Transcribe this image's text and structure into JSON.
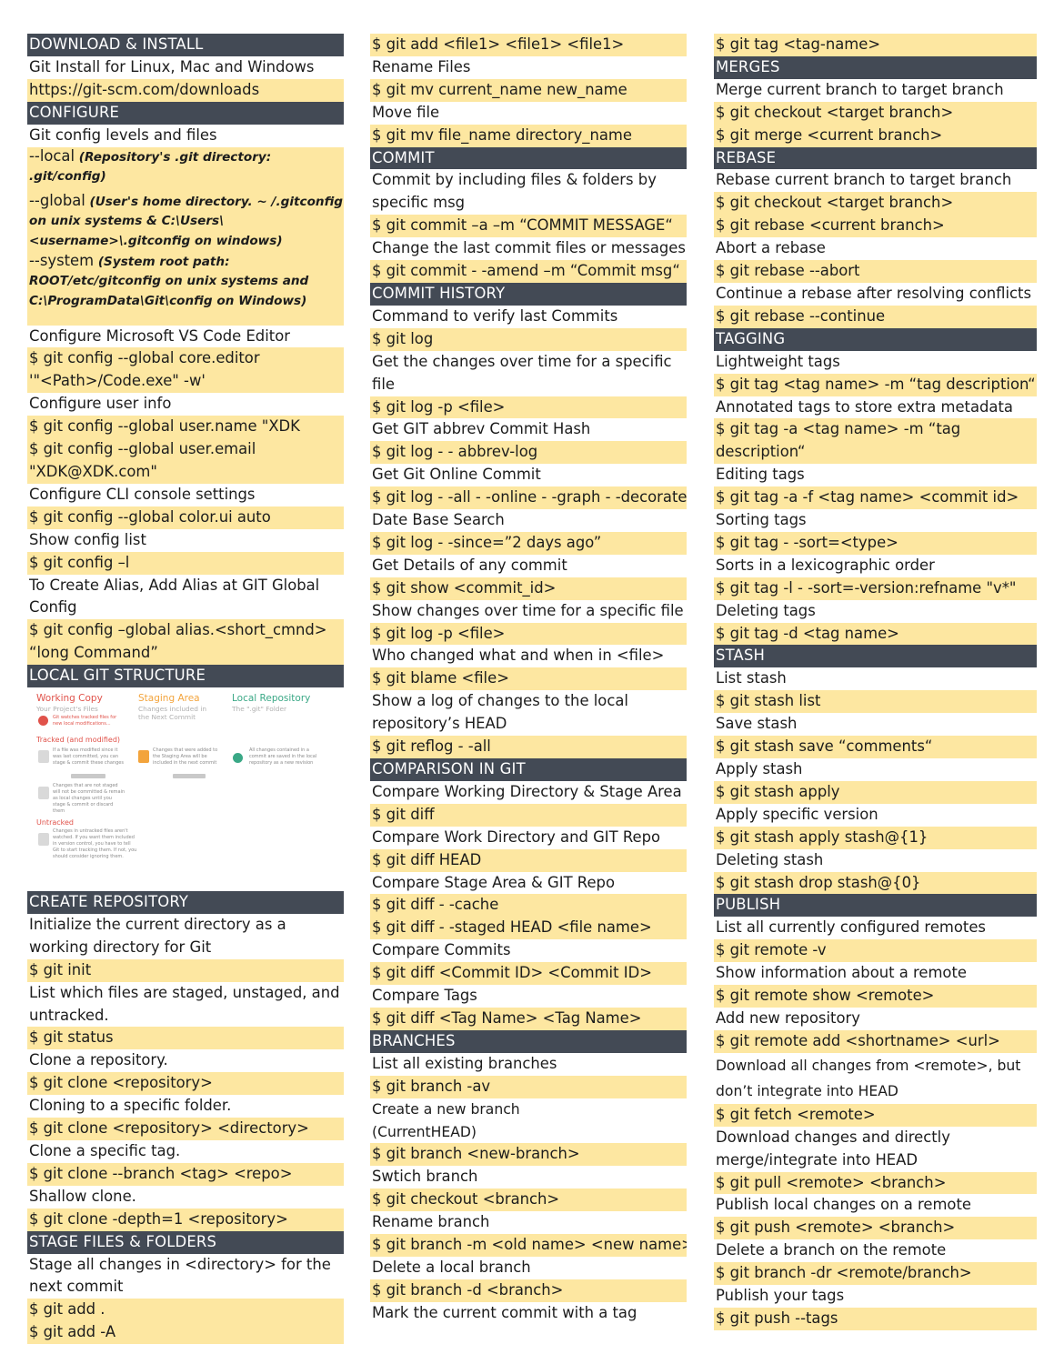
{
  "col1": {
    "i0": "DOWNLOAD & INSTALL",
    "i1": "Git Install for Linux, Mac and Windows",
    "i2": "https://git-scm.com/downloads",
    "i3": "CONFIGURE",
    "i4": "Git config levels and files",
    "i5_a": "--local",
    "i5_b": " (Repository's .git directory: .git/config)",
    "i6_a": "--global",
    "i6_b": " (User's home directory. ~ /.gitconfig on unix systems & C:\\Users\\<username>\\.gitconfig on windows)",
    "i7_a": "--system",
    "i7_b": " (System root path: ROOT/etc/gitconfig on unix systems and C:\\ProgramData\\Git\\config on Windows)",
    "i8": "Configure Microsoft VS Code Editor",
    "i9": "$ git config --global core.editor",
    "i10": "'\"<Path>/Code.exe\" -w'",
    "i11": "Configure user info",
    "i12": "$ git config --global user.name \"XDK",
    "i13": "$ git config --global user.email",
    "i14": "\"XDK@XDK.com\"",
    "i15": "Configure CLI console settings",
    "i16": "$ git config --global color.ui auto",
    "i17": "Show config list",
    "i18": "$ git config –l",
    "i19": "To Create Alias, Add Alias at GIT Global",
    "i20": "Config",
    "i21": "$ git config –global alias.<short_cmnd>",
    "i22": "“long Command”",
    "i23": "LOCAL GIT STRUCTURE",
    "structure": {
      "working_copy": "Working Copy",
      "working_copy_sub": "Your Project's Files",
      "staging_area": "Staging Area",
      "staging_area_sub1": "Changes included in",
      "staging_area_sub2": "the Next Commit",
      "local_repo": "Local Repository",
      "local_repo_sub": "The \".git\" Folder",
      "watches": "Git watches tracked files for new local modifications...",
      "tracked": "Tracked (and modified)",
      "tracked_note": "If a file was modified since it was last committed, you can stage & commit these changes",
      "staged_note": "Changes that were added to the Staging Area will be included in the next commit",
      "committed_note": "All changes contained in a commit are saved in the local repository as a new revision",
      "not_staged_note": "Changes that are not staged will not be committed & remain as local changes until you stage & commit or discard them",
      "untracked": "Untracked",
      "untracked_note": "Changes in untracked files aren't watched. If you want them included in version control, you have to tell Git to start tracking them. If not, you should consider ignoring them."
    },
    "i24": "CREATE REPOSITORY",
    "i25": "Initialize the current directory as a",
    "i26": "working directory for Git",
    "i27": "$ git init",
    "i28": "List which files are staged, unstaged, and",
    "i29": "untracked.",
    "i30": "$ git status",
    "i31": "Clone a repository.",
    "i32": "$ git clone <repository>",
    "i33": "Cloning to a specific folder.",
    "i34": "$ git clone <repository> <directory>",
    "i35": "Clone a specific tag.",
    "i36": "$ git clone --branch <tag> <repo>",
    "i37": "Shallow clone.",
    "i38": "$ git clone -depth=1 <repository>",
    "i39": "STAGE FILES & FOLDERS",
    "i40": "Stage all changes in <directory> for the",
    "i41": "next commit",
    "i42": "$ git add .",
    "i43": "$ git add -A"
  },
  "col2": {
    "i0": "$ git add <file1> <file1> <file1>",
    "i1": "Rename Files",
    "i2": "$ git mv current_name new_name",
    "i3": "Move file",
    "i4": "$ git mv file_name directory_name",
    "i5": "COMMIT",
    "i6": "Commit by including files & folders by",
    "i7": "specific msg",
    "i8": "$ git commit –a –m  “COMMIT MESSAGE“",
    "i9": "Change the last commit files or messages",
    "i10": "$ git commit - -amend –m “Commit msg“",
    "i11": "COMMIT HISTORY",
    "i12": "Command to verify last Commits",
    "i13": "$ git log",
    "i14": "Get the changes over time for a specific",
    "i15": "file",
    "i16": "$ git log -p <file>",
    "i17": "Get GIT abbrev Commit Hash",
    "i18": "$ git log - - abbrev-log",
    "i19": "Get Git Online Commit",
    "i20": "$ git log - -all - -online - -graph - -decorate",
    "i21": "Date Base Search",
    "i22": "$ git log - -since=”2 days ago”",
    "i23": "Get Details of any commit",
    "i24": "$ git show <commit_id>",
    "i25": "Show changes over time for a specific file",
    "i26": "$ git log -p <file>",
    "i27": "Who changed what and when in <file>",
    "i28": "$ git blame <file>",
    "i29": "Show a log of changes to the local",
    "i30": "repository’s HEAD",
    "i31": "$ git reflog - -all",
    "i32": "COMPARISON IN GIT",
    "i33": "Compare Working Directory & Stage Area",
    "i34": "$ git diff",
    "i35": "Compare Work Directory and GIT Repo",
    "i36": "$ git diff HEAD",
    "i37": "Compare Stage Area & GIT Repo",
    "i38": "$ git diff - -cache",
    "i39": "$ git diff - -staged HEAD <file name>",
    "i40": "Compare Commits",
    "i41": "$ git diff <Commit ID> <Commit ID>",
    "i42": "Compare Tags",
    "i43": "$ git diff <Tag Name> <Tag Name>",
    "i44": "BRANCHES",
    "i45": "List all existing branches",
    "i46": "$ git branch -av",
    "i47": "Create a new branch",
    "i48": "(CurrentHEAD)",
    "i49": "$ git branch <new-branch>",
    "i50": "Swtich branch",
    "i51": "$ git checkout <branch>",
    "i52": "Rename branch",
    "i53": "$ git branch -m <old name> <new name>",
    "i54": "Delete a local branch",
    "i55": "$ git branch -d <branch>",
    "i56": "Mark the current commit with a tag"
  },
  "col3": {
    "i0": "$ git tag <tag-name>",
    "i1": "MERGES",
    "i2": "Merge current branch to target branch",
    "i3": "$ git checkout <target branch>",
    "i4": "$ git merge <current branch>",
    "i5": "REBASE",
    "i6": "Rebase current branch to target branch",
    "i7": "$ git checkout <target branch>",
    "i8": "$ git rebase <current branch>",
    "i9": "Abort a rebase",
    "i10": "$ git rebase --abort",
    "i11": "Continue a rebase after resolving conflicts",
    "i12": "$ git rebase --continue",
    "i13": "TAGGING",
    "i14": "Lightweight tags",
    "i15": "$ git tag <tag name> -m “tag description“",
    "i16": "Annotated tags to store extra metadata",
    "i17": "$ git tag -a <tag name> -m “tag",
    "i18": "description“",
    "i19": "Editing tags",
    "i20": "$ git tag -a -f <tag name> <commit id>",
    "i21": "Sorting tags",
    "i22": "$ git tag - -sort=<type>",
    "i23": "Sorts in a lexicographic order",
    "i24": "$ git tag -l - -sort=-version:refname \"v*\"",
    "i25": "Deleting tags",
    "i26": "$ git tag -d <tag name>",
    "i27": "STASH",
    "i28": "List stash",
    "i29": "$ git stash list",
    "i30": "Save stash",
    "i31": "$ git stash save “comments“",
    "i32": "Apply stash",
    "i33": "$ git stash apply",
    "i34": "Apply specific version",
    "i35": "$ git stash apply stash@{1}",
    "i36": "Deleting stash",
    "i37": "$ git stash drop stash@{0}",
    "i38": "PUBLISH",
    "i39": "List all currently configured remotes",
    "i40": "$ git remote -v",
    "i41": "Show information about a remote",
    "i42": "$ git remote show <remote>",
    "i43": "Add new repository",
    "i44": "$ git remote add <shortname> <url>",
    "i45": "Download all changes from <remote>, but",
    "i46": "don’t integrate into HEAD",
    "i47": "$ git fetch <remote>",
    "i48": "Download changes and directly",
    "i49": "merge/integrate into HEAD",
    "i50": "$ git pull <remote> <branch>",
    "i51": "Publish local changes on a remote",
    "i52": "$ git push <remote> <branch>",
    "i53": "Delete a branch on the remote",
    "i54": "$ git branch -dr <remote/branch>",
    "i55": "Publish your tags",
    "i56": "$ git push --tags"
  },
  "colors": {
    "header_bg": "#434a55",
    "command_bg": "#fde7a1",
    "working_copy": "#e0524a",
    "staging_area": "#f3a43c",
    "local_repo": "#3aa886"
  }
}
